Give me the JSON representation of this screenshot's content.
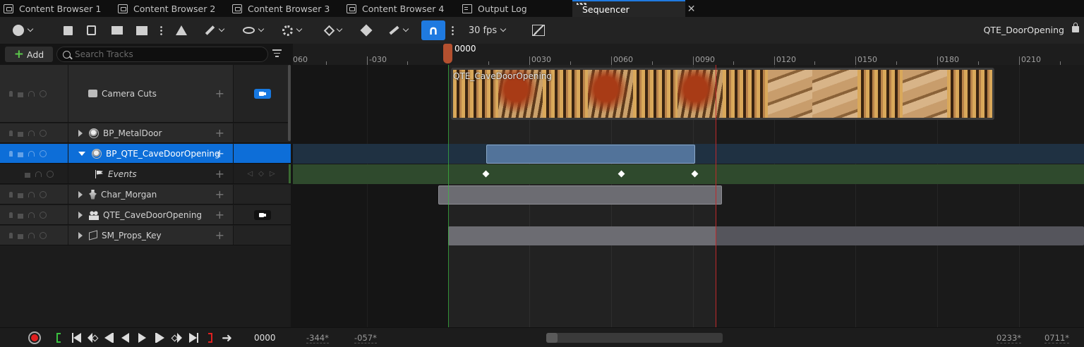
{
  "tabs": [
    {
      "label": "Content Browser 1",
      "icon": "folder-icon"
    },
    {
      "label": "Content Browser 2",
      "icon": "folder-icon"
    },
    {
      "label": "Content Browser 3",
      "icon": "folder-icon"
    },
    {
      "label": "Content Browser 4",
      "icon": "folder-icon"
    },
    {
      "label": "Output Log",
      "icon": "log-icon"
    },
    {
      "label": "Sequencer",
      "icon": "clapper-icon",
      "active": true
    }
  ],
  "toolbar": {
    "fps": "30 fps",
    "sequence_name": "QTE_DoorOpening",
    "snap_active": true
  },
  "outliner": {
    "add_label": "Add",
    "search_placeholder": "Search Tracks",
    "tracks": [
      {
        "label": "Camera Cuts",
        "icon": "camera-cuts-icon"
      },
      {
        "label": "BP_MetalDoor",
        "icon": "actor-icon"
      },
      {
        "label": "BP_QTE_CaveDoorOpening",
        "icon": "actor-icon",
        "selected": true
      },
      {
        "label": "Events",
        "icon": "flag-icon"
      },
      {
        "label": "Char_Morgan",
        "icon": "character-icon"
      },
      {
        "label": "QTE_CaveDoorOpening",
        "icon": "group-icon"
      },
      {
        "label": "SM_Props_Key",
        "icon": "static-mesh-icon"
      }
    ]
  },
  "timeline": {
    "ruler_labels": [
      "060",
      "-030",
      "0000",
      "0030",
      "0060",
      "0090",
      "0120",
      "0150",
      "0180",
      "0210"
    ],
    "playhead_label": "0000",
    "camera_cut_label": "QTE_CaveDoorOpening"
  },
  "transport": {
    "current_time": "0000",
    "range_start": "-344*",
    "range_view_start": "-057*",
    "range_view_end": "0233*",
    "range_end": "0711*"
  },
  "colors": {
    "accent": "#1f7ae0",
    "selected_row": "#0d6ed8",
    "event_lane": "#2f4a2d",
    "playhead": "#b4502f",
    "end_marker": "#c0282a",
    "start_marker": "#3bc040"
  }
}
